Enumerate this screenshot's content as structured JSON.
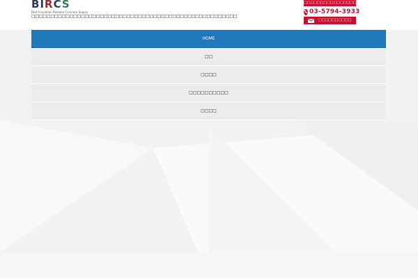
{
  "header": {
    "logo": {
      "letters": [
        "B",
        "I",
        "R",
        "C",
        "S"
      ],
      "subtitle": "Best Insulation Remake Concrete Supply"
    },
    "tagline": "□□□□□□□□□□□□□□□□□□□□□□□□□□□□□□□□□□□□□□□□□□□□□□□□□□□□□□",
    "contact": {
      "top_label": "□□□□□□□□□□□□□□□□",
      "phone_icon": "phone-icon",
      "phone_number": "03-5794-3933",
      "mail_icon": "mail-icon",
      "mail_label": "□□□□□□□□□□",
      "accent_color": "#c8102e"
    }
  },
  "nav": {
    "active_color": "#1f78b9",
    "items": [
      {
        "label": "HOME"
      },
      {
        "label": "□□"
      },
      {
        "label": "□□□□"
      },
      {
        "label": "□□□□□□□□□□"
      },
      {
        "label": "□□□□"
      }
    ]
  }
}
